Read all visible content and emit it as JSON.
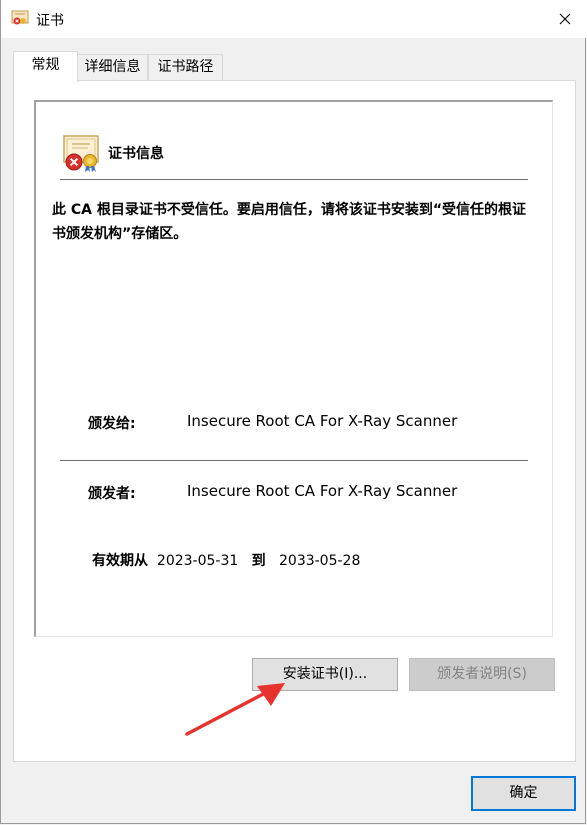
{
  "window": {
    "title": "证书"
  },
  "tabs": [
    {
      "label": "常规"
    },
    {
      "label": "详细信息"
    },
    {
      "label": "证书路径"
    }
  ],
  "general": {
    "heading": "证书信息",
    "warning": "此 CA 根目录证书不受信任。要启用信任，请将该证书安装到“受信任的根证书颁发机构”存储区。",
    "issued_to_label": "颁发给:",
    "issued_to_value": "Insecure Root CA For X-Ray Scanner",
    "issued_by_label": "颁发者:",
    "issued_by_value": "Insecure Root CA For X-Ray Scanner",
    "validity_label": "有效期从",
    "valid_from": "2023-05-31",
    "validity_to_label": "到",
    "valid_to": "2033-05-28",
    "install_button": "安装证书(I)...",
    "issuer_statement_button": "颁发者说明(S)"
  },
  "footer": {
    "ok_button": "确定"
  },
  "colors": {
    "accent": "#0078d7",
    "annotation_arrow": "#e8322d"
  }
}
